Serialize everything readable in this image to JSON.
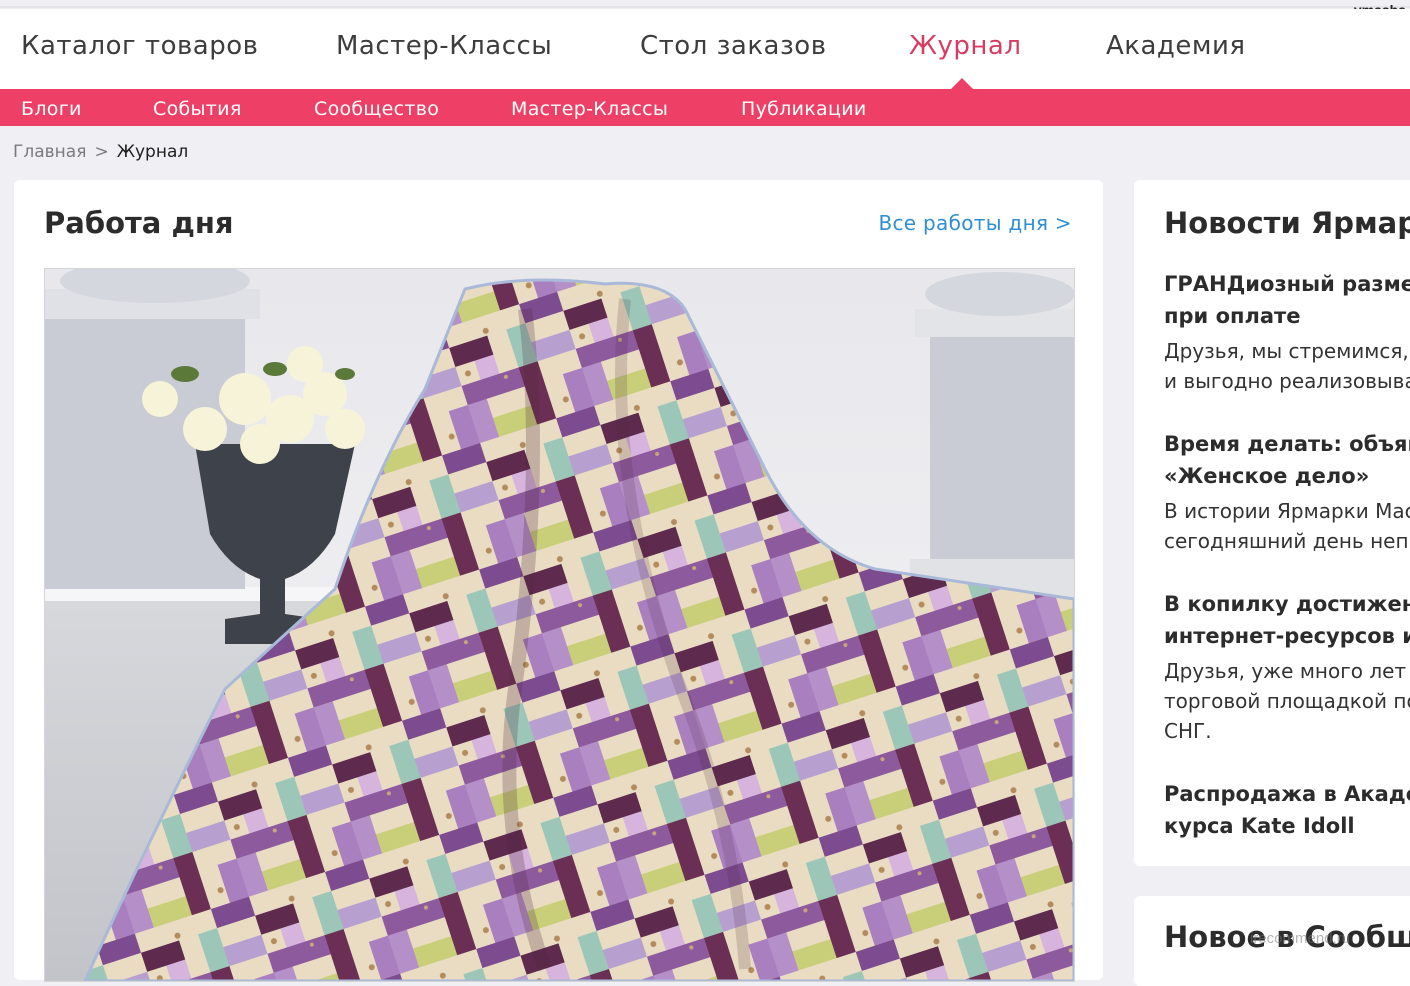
{
  "user": {
    "name": "vmasha"
  },
  "main_nav": [
    {
      "label": "Каталог товаров",
      "active": false
    },
    {
      "label": "Мастер-Классы",
      "active": false
    },
    {
      "label": "Стол заказов",
      "active": false
    },
    {
      "label": "Журнал",
      "active": true
    },
    {
      "label": "Академия",
      "active": false
    }
  ],
  "sub_nav": [
    "Блоги",
    "События",
    "Сообщество",
    "Мастер-Классы",
    "Публикации"
  ],
  "breadcrumb": {
    "home": "Главная",
    "separator": ">",
    "current": "Журнал"
  },
  "work_of_day": {
    "title": "Работа дня",
    "all_link": "Все работы дня >",
    "image_icon": "patchwork-quilt-photo"
  },
  "news": {
    "title": "Новости Ярмарк",
    "items": [
      {
        "title_lines": [
          "ГРАНДиозный разме",
          "при оплате"
        ],
        "text_lines": [
          "Друзья, мы стремимся,",
          "и выгодно реализовыва"
        ]
      },
      {
        "title_lines": [
          "Время делать: объяв",
          "«Женское дело»"
        ],
        "text_lines": [
          "В истории Ярмарки Мас",
          "сегодняшний день непр"
        ]
      },
      {
        "title_lines": [
          "В копилку достижен",
          "интернет-ресурсов и"
        ],
        "text_lines": [
          "Друзья, уже много лет Я",
          "торговой площадкой по",
          "СНГ."
        ]
      },
      {
        "title_lines": [
          "Распродажа в Акаде",
          "курса Kate Idoll"
        ],
        "text_lines": []
      }
    ]
  },
  "community": {
    "title": "Новое в Сообще"
  },
  "watermark": "irecommend.ru",
  "colors": {
    "accent": "#ee4066",
    "active_nav": "#d63d62",
    "link": "#2f8fd1",
    "page_bg": "#f0eff4"
  }
}
